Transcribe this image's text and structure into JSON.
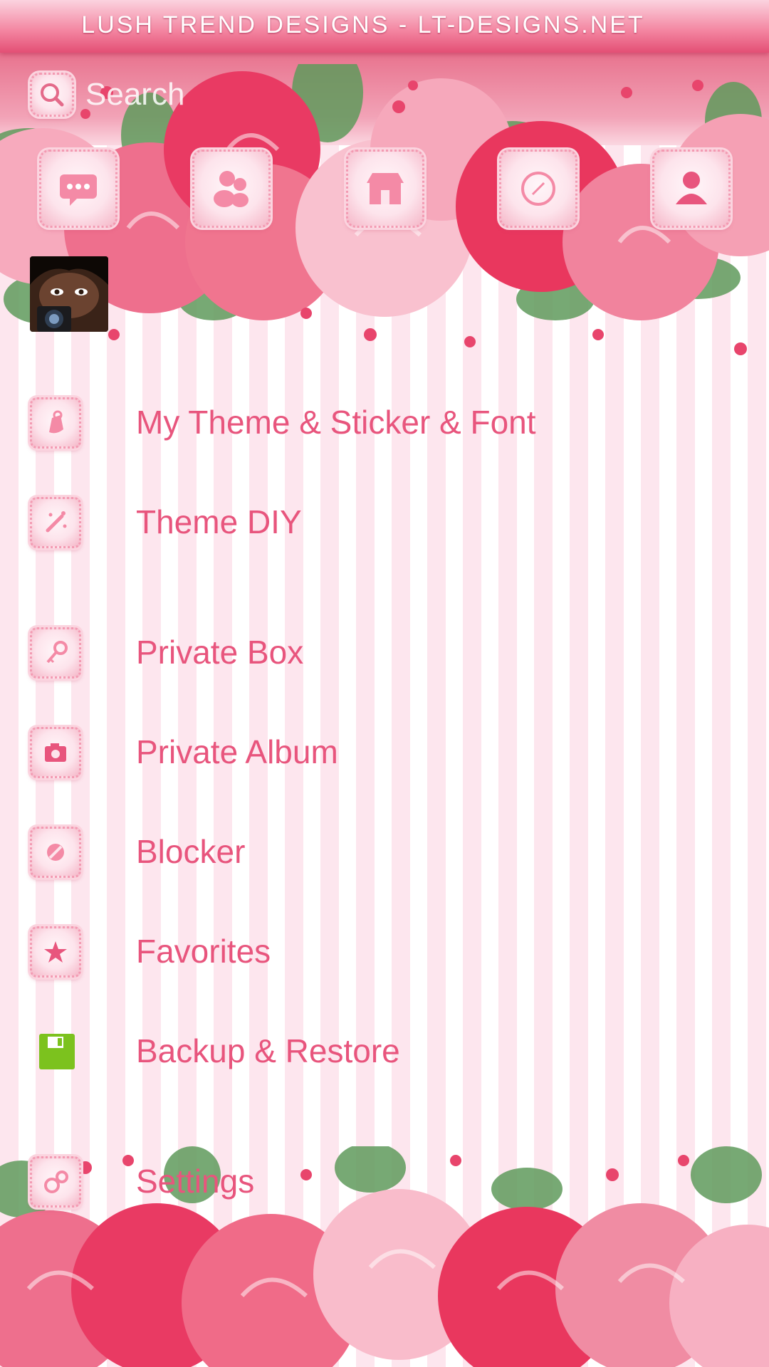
{
  "banner": {
    "text": "LUSH TREND DESIGNS - LT-DESIGNS.NET"
  },
  "search": {
    "placeholder": "Search"
  },
  "top_icons": [
    {
      "name": "messages-icon"
    },
    {
      "name": "contacts-icon"
    },
    {
      "name": "store-icon"
    },
    {
      "name": "explore-icon"
    },
    {
      "name": "profile-icon"
    }
  ],
  "menu": {
    "items": [
      {
        "label": "My Theme & Sticker & Font",
        "icon": "theme-icon"
      },
      {
        "label": "Theme DIY",
        "icon": "diy-wand-icon"
      },
      {
        "label": "Private Box",
        "icon": "key-icon"
      },
      {
        "label": "Private Album",
        "icon": "camera-icon"
      },
      {
        "label": "Blocker",
        "icon": "block-icon"
      },
      {
        "label": "Favorites",
        "icon": "star-icon"
      },
      {
        "label": "Backup & Restore",
        "icon": "floppy-icon"
      },
      {
        "label": "Settings",
        "icon": "gear-icon"
      }
    ]
  },
  "colors": {
    "accent": "#e8557d",
    "banner": "#e34f75",
    "stripe": "#fde6ee",
    "backup_icon": "#7cc21e"
  }
}
